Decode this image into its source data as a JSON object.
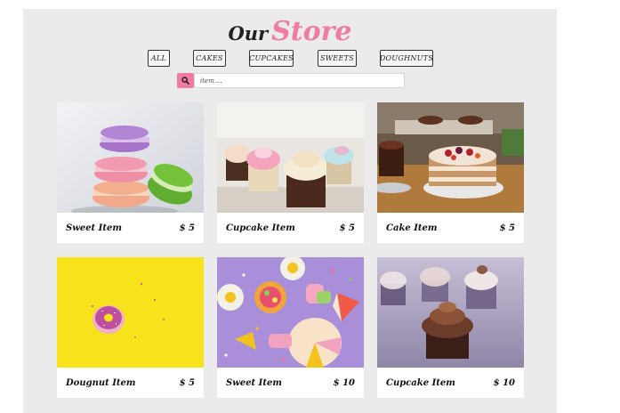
{
  "title": {
    "prefix": "Our",
    "highlight": "Store"
  },
  "filters": [
    "ALL",
    "CAKES",
    "CUPCAKES",
    "SWEETS",
    "DOUGHNUTS"
  ],
  "search": {
    "placeholder": "item...."
  },
  "colors": {
    "accent": "#f07ba3",
    "panel": "#ebebeb"
  },
  "items": [
    {
      "name": "Sweet Item",
      "price": "$ 5",
      "image": "macarons"
    },
    {
      "name": "Cupcake Item",
      "price": "$ 5",
      "image": "cupcakes"
    },
    {
      "name": "Cake Item",
      "price": "$ 5",
      "image": "cake"
    },
    {
      "name": "Dougnut Item",
      "price": "$ 5",
      "image": "doughnut"
    },
    {
      "name": "Sweet Item",
      "price": "$ 10",
      "image": "sweets"
    },
    {
      "name": "Cupcake Item",
      "price": "$ 10",
      "image": "cupcake-chocolate"
    }
  ]
}
